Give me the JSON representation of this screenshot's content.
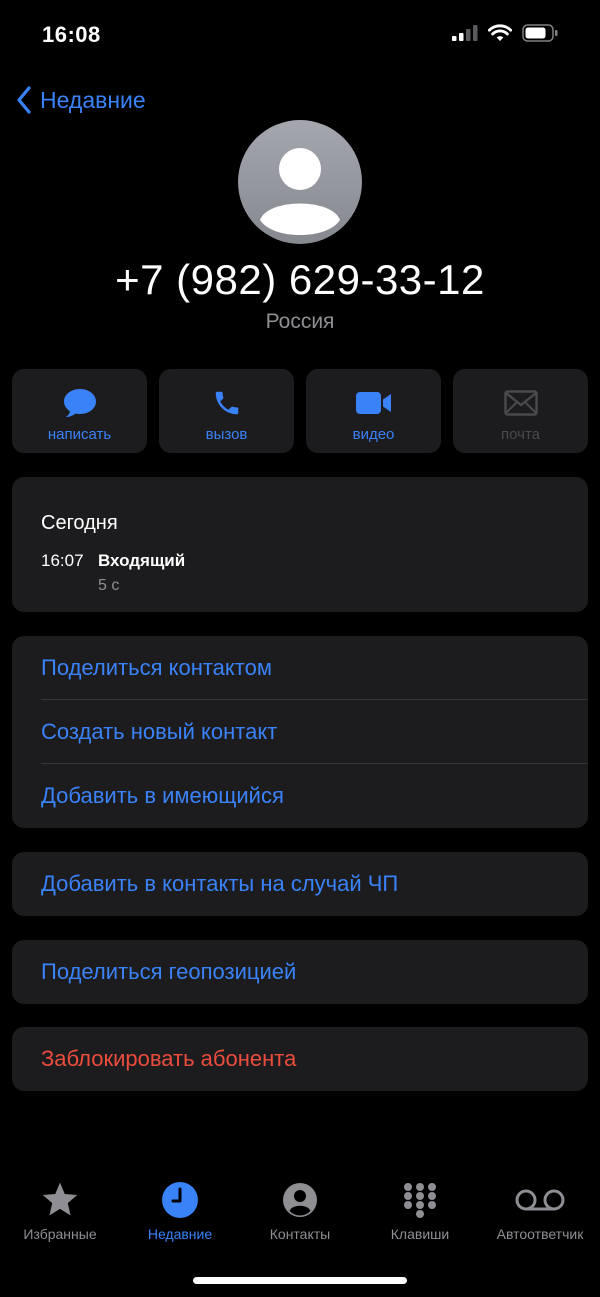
{
  "status": {
    "time": "16:08"
  },
  "nav": {
    "back_label": "Недавние"
  },
  "contact": {
    "number": "+7 (982) 629-33-12",
    "country": "Россия"
  },
  "actions": [
    {
      "label": "написать",
      "icon": "message-icon",
      "enabled": true
    },
    {
      "label": "вызов",
      "icon": "phone-icon",
      "enabled": true
    },
    {
      "label": "видео",
      "icon": "video-icon",
      "enabled": true
    },
    {
      "label": "почта",
      "icon": "mail-icon",
      "enabled": false
    }
  ],
  "history": {
    "day": "Сегодня",
    "time": "16:07",
    "type": "Входящий",
    "duration": "5 с"
  },
  "options": {
    "share_contact": "Поделиться контактом",
    "create_contact": "Создать новый контакт",
    "add_existing": "Добавить в имеющийся",
    "emergency": "Добавить в контакты на случай ЧП",
    "share_location": "Поделиться геопозицией",
    "block": "Заблокировать абонента"
  },
  "tabs": [
    {
      "label": "Избранные",
      "icon": "star-icon"
    },
    {
      "label": "Недавние",
      "icon": "clock-icon",
      "active": true
    },
    {
      "label": "Контакты",
      "icon": "person-circle-icon"
    },
    {
      "label": "Клавиши",
      "icon": "keypad-icon"
    },
    {
      "label": "Автоответчик",
      "icon": "voicemail-icon"
    }
  ],
  "colors": {
    "accent": "#3a82f7",
    "destructive": "#eb4d3d",
    "card": "#1c1c1e",
    "background": "#000000"
  }
}
